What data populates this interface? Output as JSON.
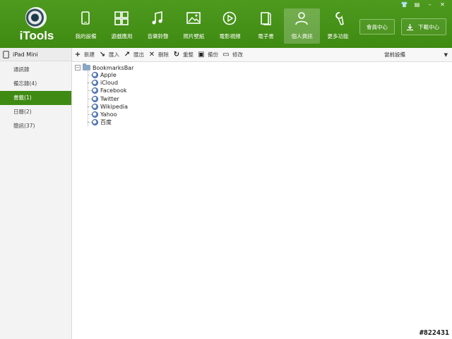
{
  "app": {
    "logo_text": "iTools"
  },
  "nav": {
    "items": [
      {
        "label": "我的設備",
        "icon": "device-icon",
        "active": false
      },
      {
        "label": "遊戲應用",
        "icon": "apps-icon",
        "active": false
      },
      {
        "label": "音樂鈴聲",
        "icon": "music-icon",
        "active": false
      },
      {
        "label": "照片壁紙",
        "icon": "photo-icon",
        "active": false
      },
      {
        "label": "電影視頻",
        "icon": "video-icon",
        "active": false
      },
      {
        "label": "電子書",
        "icon": "ebook-icon",
        "active": false
      },
      {
        "label": "個人資訊",
        "icon": "person-icon",
        "active": true
      },
      {
        "label": "更多功能",
        "icon": "tools-icon",
        "active": false
      }
    ]
  },
  "header": {
    "member_label": "會員中心",
    "download_label": "下載中心"
  },
  "sidebar": {
    "device_name": "iPad Mini",
    "items": [
      {
        "label": "通訊錄",
        "active": false
      },
      {
        "label": "備忘錄(4)",
        "active": false
      },
      {
        "label": "書籤(1)",
        "active": true
      },
      {
        "label": "日曆(2)",
        "active": false
      },
      {
        "label": "簡訊(37)",
        "active": false
      }
    ]
  },
  "toolbar": {
    "new": "新建",
    "import": "匯入",
    "export": "匯出",
    "delete": "刪除",
    "reload": "重整",
    "backup": "備份",
    "modify": "修改",
    "device_select": "當前設備"
  },
  "tree": {
    "root": "BookmarksBar",
    "children": [
      "Apple",
      "iCloud",
      "Facebook",
      "Twitter",
      "Wikipedia",
      "Yahoo",
      "百度"
    ]
  },
  "watermark": "#822431",
  "colors": {
    "brand_green": "#3f8a12"
  }
}
